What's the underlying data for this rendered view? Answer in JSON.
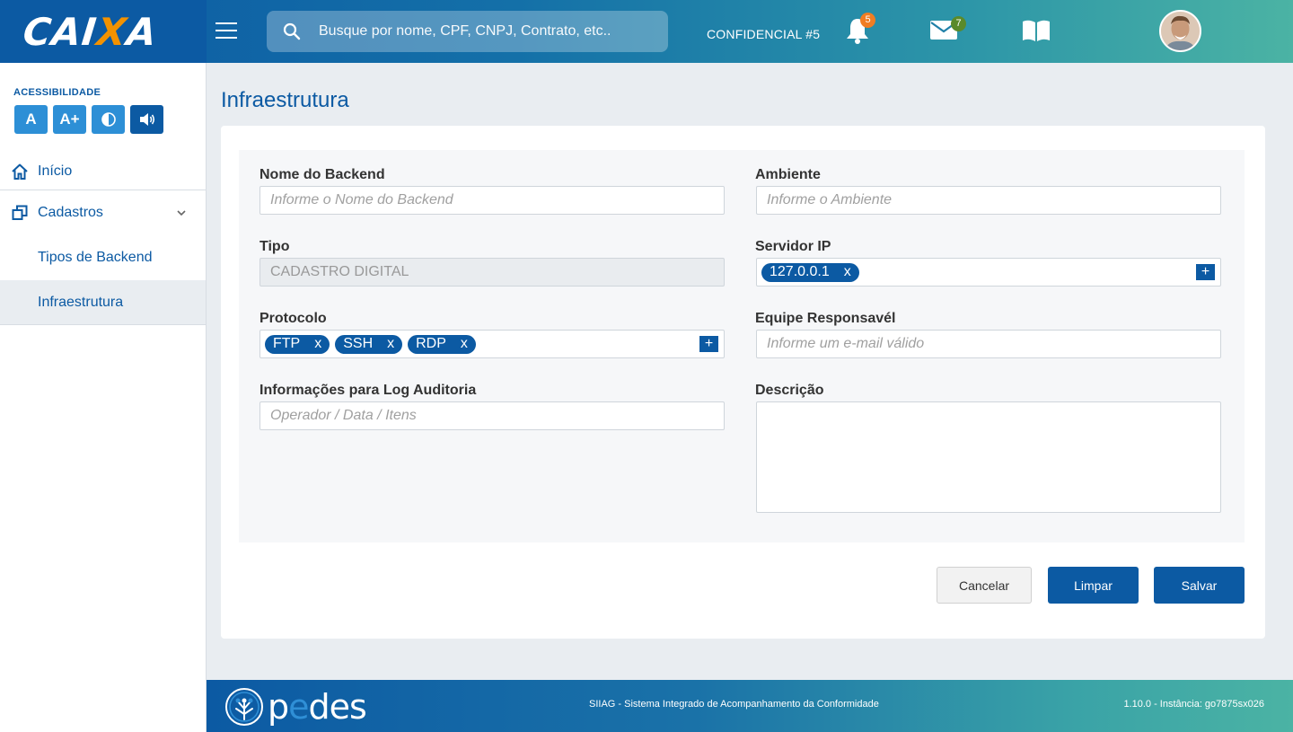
{
  "header": {
    "logo": "CAIXA",
    "search_placeholder": "Busque por nome, CPF, CNPJ, Contrato, etc..",
    "confidential": "CONFIDENCIAL #5",
    "notifications_count": "5",
    "messages_count": "7",
    "colors": {
      "notif_badge": "#f07d23",
      "msg_badge": "#5a8a2a"
    }
  },
  "sidebar": {
    "accessibility_label": "ACESSIBILIDADE",
    "acc_buttons": [
      "A",
      "A+",
      "◐",
      "🔊"
    ],
    "items": [
      {
        "label": "Início",
        "icon": "home-icon"
      },
      {
        "label": "Cadastros",
        "icon": "copy-icon"
      },
      {
        "label": "Tipos de Backend"
      },
      {
        "label": "Infraestrutura"
      }
    ]
  },
  "main": {
    "title": "Infraestrutura",
    "fields": {
      "backend_name": {
        "label": "Nome do Backend",
        "placeholder": "Informe o Nome do Backend"
      },
      "environment": {
        "label": "Ambiente",
        "placeholder": "Informe o Ambiente"
      },
      "type": {
        "label": "Tipo",
        "value": "CADASTRO DIGITAL"
      },
      "server_ip": {
        "label": "Servidor IP",
        "tags": [
          "127.0.0.1"
        ]
      },
      "protocol": {
        "label": "Protocolo",
        "tags": [
          "FTP",
          "SSH",
          "RDP"
        ]
      },
      "team": {
        "label": "Equipe Responsavél",
        "placeholder": "Informe um e-mail válido"
      },
      "log_info": {
        "label": "Informações para Log Auditoria",
        "placeholder": "Operador / Data / Itens"
      },
      "description": {
        "label": "Descrição"
      }
    },
    "tag_remove": "x",
    "tag_add": "+",
    "buttons": {
      "cancel": "Cancelar",
      "clear": "Limpar",
      "save": "Salvar"
    }
  },
  "footer": {
    "brand": "pedes",
    "system": "SIIAG  - Sistema Integrado de Acompanhamento da Conformidade",
    "version": "1.10.0 - Instância: go7875sx026"
  }
}
